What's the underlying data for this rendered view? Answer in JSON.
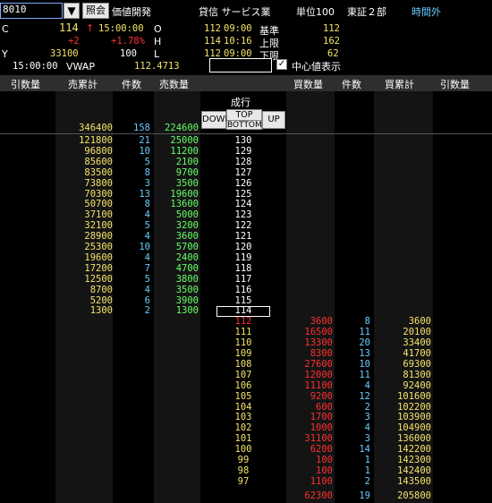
{
  "header": {
    "code": "8010",
    "query_label": "照会",
    "subtitle": "価値開発",
    "company": "貸信 サービス業",
    "unit": "単位100",
    "market": "東証２部",
    "session": "時間外",
    "dropdown_glyph": "▼"
  },
  "quote": {
    "c_label": "C",
    "c_price": "114",
    "c_arrow": "↑",
    "c_time": "15:00:00",
    "change": "+2",
    "change_pct": "+1.78%",
    "y_label": "Y",
    "y_volume": "33100",
    "y_time": "15:00:00",
    "vwap_label": "VWAP",
    "vwap": "112.4713",
    "o_label": "O",
    "h_label": "H",
    "l_label": "L",
    "l_value": "100",
    "o_price": "112",
    "o_time": "09:00",
    "h_price": "114",
    "h_time": "10:16",
    "l_price": "112",
    "l_time": "09:00",
    "base_label": "基準",
    "base": "112",
    "upper_label": "上限",
    "upper": "162",
    "lower_label": "下限",
    "lower": "62",
    "center_label": "中心値表示",
    "center_checked": "✓"
  },
  "columns": {
    "withdraw_left": "引数量",
    "sell_cum": "売累計",
    "sell_count": "件数",
    "sell_qty": "売数量",
    "buy_qty": "買数量",
    "buy_count": "件数",
    "buy_cum": "買累計",
    "withdraw_right": "引数量"
  },
  "controls": {
    "market_order": "成行",
    "down": "DOWN",
    "top": "TOP",
    "bottom": "BOTTOM",
    "up": "UP"
  },
  "totals": {
    "sell_cum": "346400",
    "sell_count": "158",
    "sell_qty": "224600",
    "buy_qty": "62300",
    "buy_count": "19",
    "buy_cum": "205800"
  },
  "sell_rows": [
    {
      "cum": "121800",
      "count": "21",
      "qty": "25000",
      "price": "130"
    },
    {
      "cum": "96800",
      "count": "10",
      "qty": "11200",
      "price": "129"
    },
    {
      "cum": "85600",
      "count": "5",
      "qty": "2100",
      "price": "128"
    },
    {
      "cum": "83500",
      "count": "8",
      "qty": "9700",
      "price": "127"
    },
    {
      "cum": "73800",
      "count": "3",
      "qty": "3500",
      "price": "126"
    },
    {
      "cum": "70300",
      "count": "13",
      "qty": "19600",
      "price": "125"
    },
    {
      "cum": "50700",
      "count": "8",
      "qty": "13600",
      "price": "124"
    },
    {
      "cum": "37100",
      "count": "4",
      "qty": "5000",
      "price": "123"
    },
    {
      "cum": "32100",
      "count": "5",
      "qty": "3200",
      "price": "122"
    },
    {
      "cum": "28900",
      "count": "4",
      "qty": "3600",
      "price": "121"
    },
    {
      "cum": "25300",
      "count": "10",
      "qty": "5700",
      "price": "120"
    },
    {
      "cum": "19600",
      "count": "4",
      "qty": "2400",
      "price": "119"
    },
    {
      "cum": "17200",
      "count": "7",
      "qty": "4700",
      "price": "118"
    },
    {
      "cum": "12500",
      "count": "5",
      "qty": "3800",
      "price": "117"
    },
    {
      "cum": "8700",
      "count": "4",
      "qty": "3500",
      "price": "116"
    },
    {
      "cum": "5200",
      "count": "6",
      "qty": "3900",
      "price": "115"
    },
    {
      "cum": "1300",
      "count": "2",
      "qty": "1300",
      "price": "114"
    }
  ],
  "buy_rows": [
    {
      "price": "112",
      "qty": "3600",
      "count": "8",
      "cum": "3600"
    },
    {
      "price": "111",
      "qty": "16500",
      "count": "11",
      "cum": "20100"
    },
    {
      "price": "110",
      "qty": "13300",
      "count": "20",
      "cum": "33400"
    },
    {
      "price": "109",
      "qty": "8300",
      "count": "13",
      "cum": "41700"
    },
    {
      "price": "108",
      "qty": "27600",
      "count": "10",
      "cum": "69300"
    },
    {
      "price": "107",
      "qty": "12000",
      "count": "11",
      "cum": "81300"
    },
    {
      "price": "106",
      "qty": "11100",
      "count": "4",
      "cum": "92400"
    },
    {
      "price": "105",
      "qty": "9200",
      "count": "12",
      "cum": "101600"
    },
    {
      "price": "104",
      "qty": "600",
      "count": "2",
      "cum": "102200"
    },
    {
      "price": "103",
      "qty": "1700",
      "count": "3",
      "cum": "103900"
    },
    {
      "price": "102",
      "qty": "1000",
      "count": "4",
      "cum": "104900"
    },
    {
      "price": "101",
      "qty": "31100",
      "count": "3",
      "cum": "136000"
    },
    {
      "price": "100",
      "qty": "6200",
      "count": "14",
      "cum": "142200"
    },
    {
      "price": "99",
      "qty": "100",
      "count": "1",
      "cum": "142300"
    },
    {
      "price": "98",
      "qty": "100",
      "count": "1",
      "cum": "142400"
    },
    {
      "price": "97",
      "qty": "1100",
      "count": "2",
      "cum": "143500"
    }
  ],
  "colors": {
    "cum": "#f5e36a",
    "count": "#66ccff",
    "qty_sell": "#66ff66",
    "qty_buy": "#ff3030",
    "price_up": "#ffffff",
    "price_low": "#f5e36a",
    "price_base": "#ff3030"
  }
}
